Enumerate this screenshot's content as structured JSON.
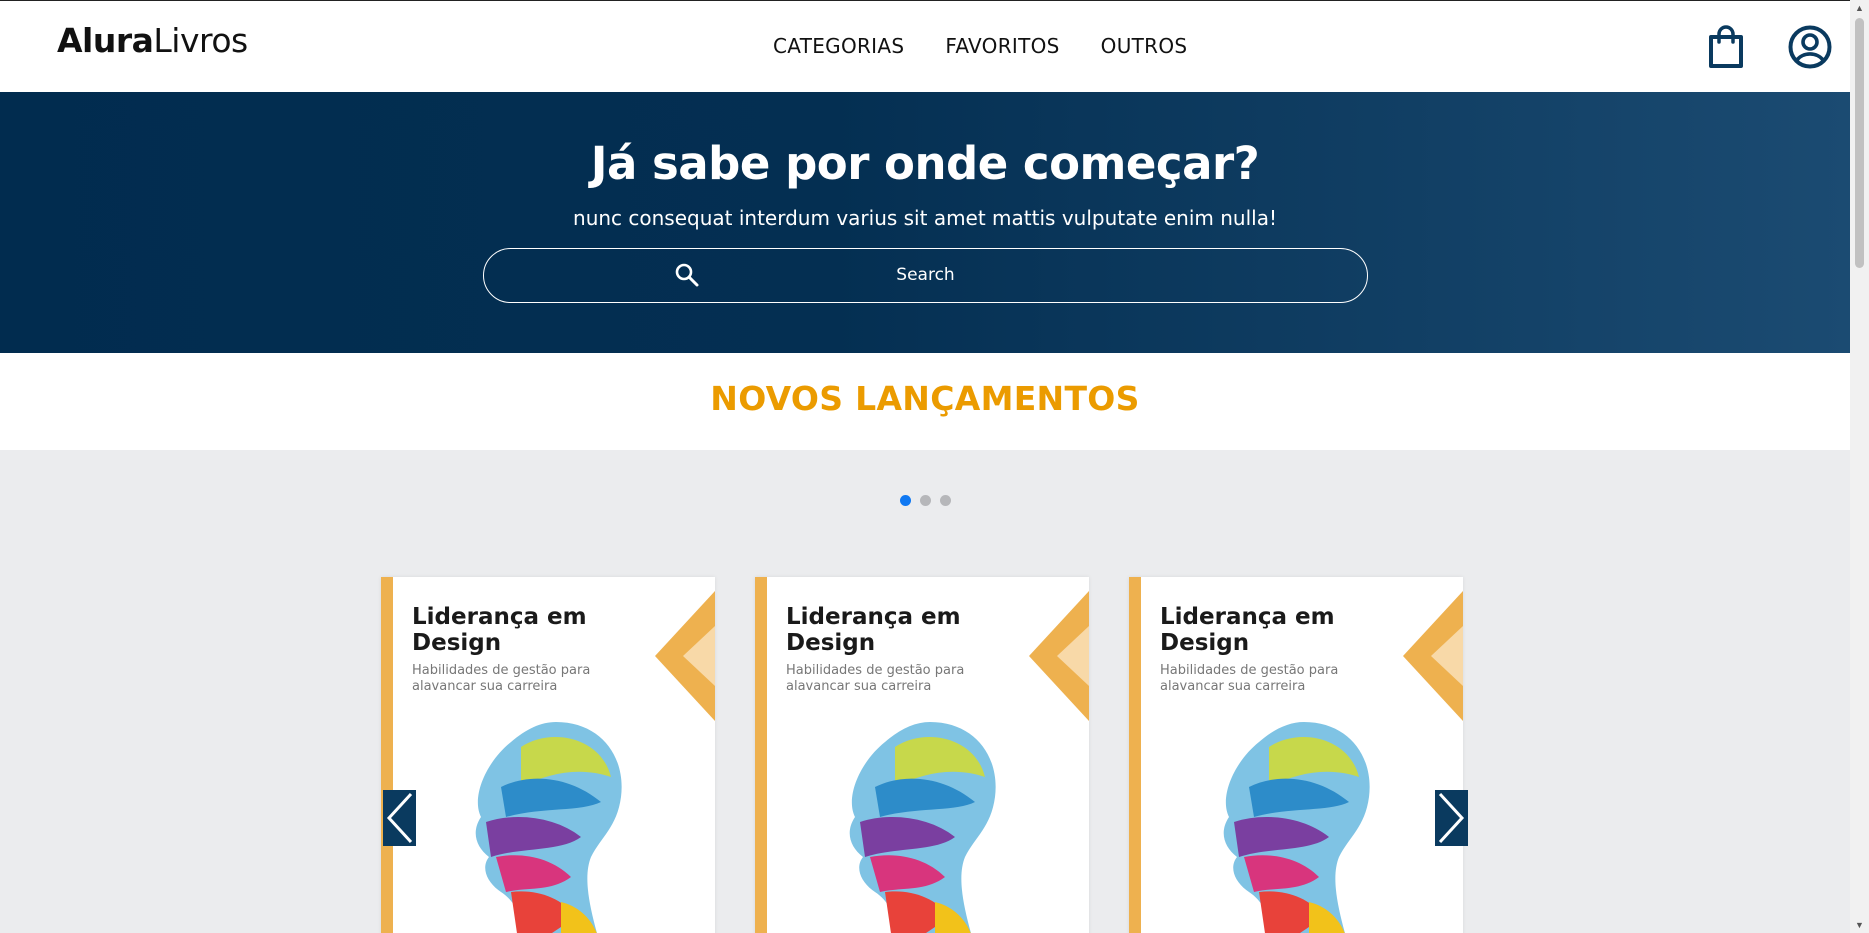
{
  "header": {
    "logo_bold": "Alura",
    "logo_light": "Livros",
    "nav": [
      "CATEGORIAS",
      "FAVORITOS",
      "OUTROS"
    ],
    "icons": [
      "shopping-bag-icon",
      "user-icon"
    ]
  },
  "hero": {
    "title": "Já sabe por onde começar?",
    "subtitle": "nunc consequat interdum varius sit amet mattis vulputate enim nulla!",
    "search_placeholder": "Search"
  },
  "releases": {
    "title": "NOVOS LANÇAMENTOS",
    "active_slide": 1,
    "slide_count": 3,
    "books": [
      {
        "title_line1": "Liderança em",
        "title_line2": "Design",
        "subtitle_line1": "Habilidades de gestão para",
        "subtitle_line2": "alavancar sua carreira"
      },
      {
        "title_line1": "Liderança em",
        "title_line2": "Design",
        "subtitle_line1": "Habilidades de gestão para",
        "subtitle_line2": "alavancar sua carreira"
      },
      {
        "title_line1": "Liderança em",
        "title_line2": "Design",
        "subtitle_line1": "Habilidades de gestão para",
        "subtitle_line2": "alavancar sua carreira"
      }
    ]
  },
  "colors": {
    "hero_bg": "#012c4f",
    "accent_orange": "#eb9b00",
    "book_accent": "#eeb14f",
    "active_dot": "#0f78f2",
    "arrow_bg": "#0a3a5f"
  }
}
